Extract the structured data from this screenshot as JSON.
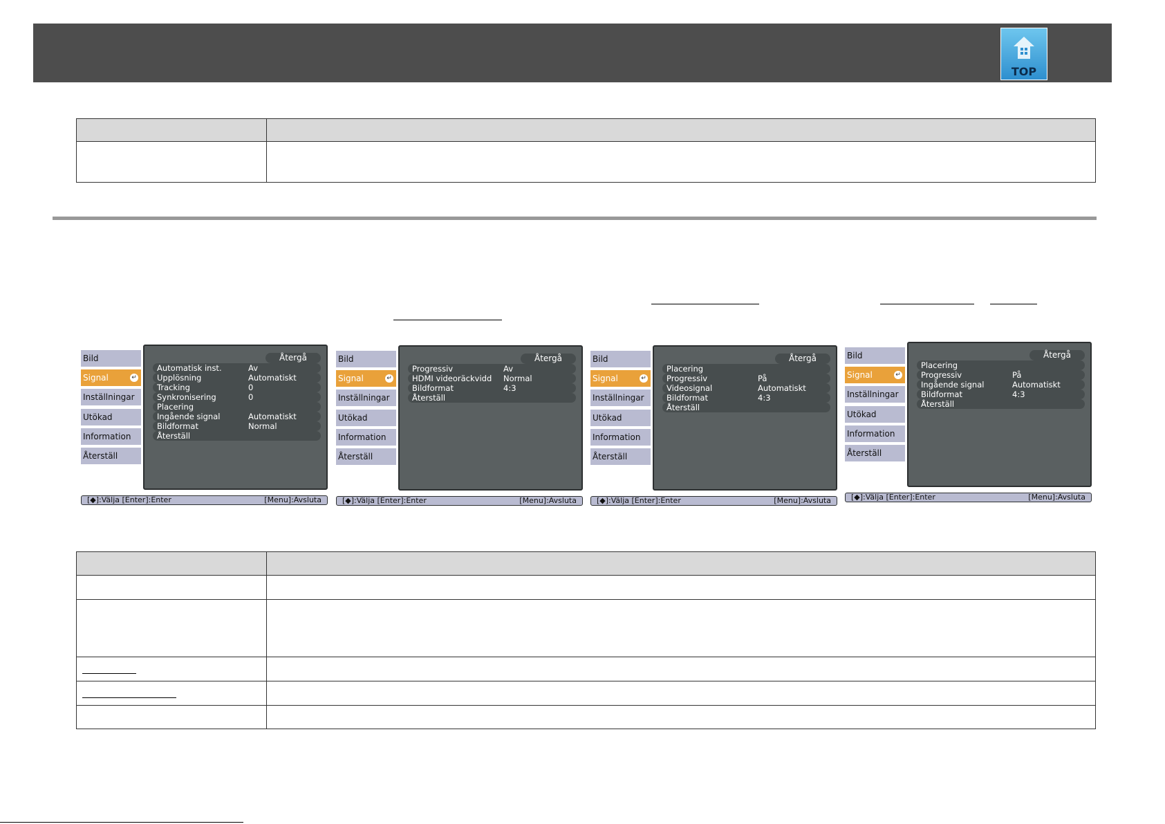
{
  "header": {
    "top_label": "TOP",
    "top_icon": "house-icon"
  },
  "top_table": {
    "header": [
      "",
      ""
    ],
    "rows": [
      [
        "",
        ""
      ]
    ]
  },
  "menus": [
    {
      "sidebar": [
        "Bild",
        "Signal",
        "Inställningar",
        "Utökad",
        "Information",
        "Återställ"
      ],
      "active": 1,
      "back": "Återgå",
      "items": [
        {
          "label": "Automatisk inst.",
          "value": "Av"
        },
        {
          "label": "Upplösning",
          "value": "Automatiskt"
        },
        {
          "label": "Tracking",
          "value": "0"
        },
        {
          "label": "Synkronisering",
          "value": "0"
        },
        {
          "label": "Placering",
          "value": ""
        },
        {
          "label": "Ingående signal",
          "value": "Automatiskt"
        },
        {
          "label": "Bildformat",
          "value": "Normal"
        },
        {
          "label": "Återställ",
          "value": ""
        }
      ],
      "status_left": "[◆]:Välja [Enter]:Enter",
      "status_right": "[Menu]:Avsluta"
    },
    {
      "sidebar": [
        "Bild",
        "Signal",
        "Inställningar",
        "Utökad",
        "Information",
        "Återställ"
      ],
      "active": 1,
      "back": "Återgå",
      "items": [
        {
          "label": "Progressiv",
          "value": "Av"
        },
        {
          "label": "HDMI videoräckvidd",
          "value": "Normal"
        },
        {
          "label": "Bildformat",
          "value": "4:3"
        },
        {
          "label": "Återställ",
          "value": ""
        }
      ],
      "status_left": "[◆]:Välja [Enter]:Enter",
      "status_right": "[Menu]:Avsluta"
    },
    {
      "sidebar": [
        "Bild",
        "Signal",
        "Inställningar",
        "Utökad",
        "Information",
        "Återställ"
      ],
      "active": 1,
      "back": "Återgå",
      "items": [
        {
          "label": "Placering",
          "value": ""
        },
        {
          "label": "Progressiv",
          "value": "På"
        },
        {
          "label": "Videosignal",
          "value": "Automatiskt"
        },
        {
          "label": "Bildformat",
          "value": "4:3"
        },
        {
          "label": "Återställ",
          "value": ""
        }
      ],
      "status_left": "[◆]:Välja [Enter]:Enter",
      "status_right": "[Menu]:Avsluta"
    },
    {
      "sidebar": [
        "Bild",
        "Signal",
        "Inställningar",
        "Utökad",
        "Information",
        "Återställ"
      ],
      "active": 1,
      "back": "Återgå",
      "items": [
        {
          "label": "Placering",
          "value": ""
        },
        {
          "label": "Progressiv",
          "value": "På"
        },
        {
          "label": "Ingående signal",
          "value": "Automatiskt"
        },
        {
          "label": "Bildformat",
          "value": "4:3"
        },
        {
          "label": "Återställ",
          "value": ""
        }
      ],
      "status_left": "[◆]:Välja [Enter]:Enter",
      "status_right": "[Menu]:Avsluta"
    }
  ],
  "bottom_table": {
    "header": [
      "",
      ""
    ],
    "rows": [
      [
        "",
        ""
      ],
      [
        "",
        ""
      ],
      [
        "",
        ""
      ],
      [
        "",
        ""
      ],
      [
        "",
        ""
      ]
    ]
  }
}
